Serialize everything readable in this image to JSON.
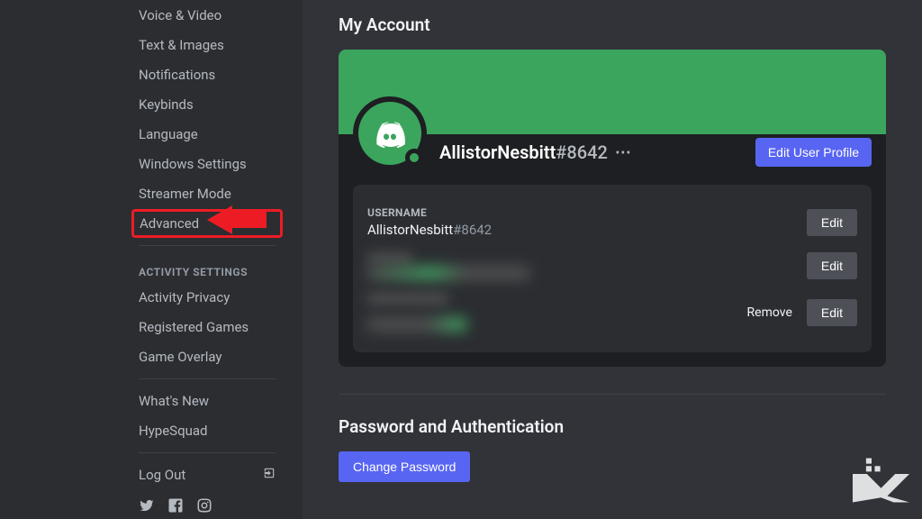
{
  "sidebar": {
    "user_settings_items": [
      "Voice & Video",
      "Text & Images",
      "Notifications",
      "Keybinds",
      "Language",
      "Windows Settings",
      "Streamer Mode",
      "Advanced"
    ],
    "activity_header": "ACTIVITY SETTINGS",
    "activity_items": [
      "Activity Privacy",
      "Registered Games",
      "Game Overlay"
    ],
    "info_items": [
      "What's New",
      "HypeSquad"
    ],
    "logout": "Log Out"
  },
  "main": {
    "title": "My Account",
    "username": "AllistorNesbitt",
    "discriminator": "#8642",
    "edit_profile": "Edit User Profile",
    "fields": {
      "username_label": "USERNAME",
      "username_value": "AllistorNesbitt",
      "username_discrim": "#8642",
      "edit": "Edit",
      "remove": "Remove"
    },
    "password_section": "Password and Authentication",
    "change_password": "Change Password"
  },
  "colors": {
    "accent": "#5865f2",
    "green": "#3ba55d",
    "highlight": "#ed1c24"
  }
}
